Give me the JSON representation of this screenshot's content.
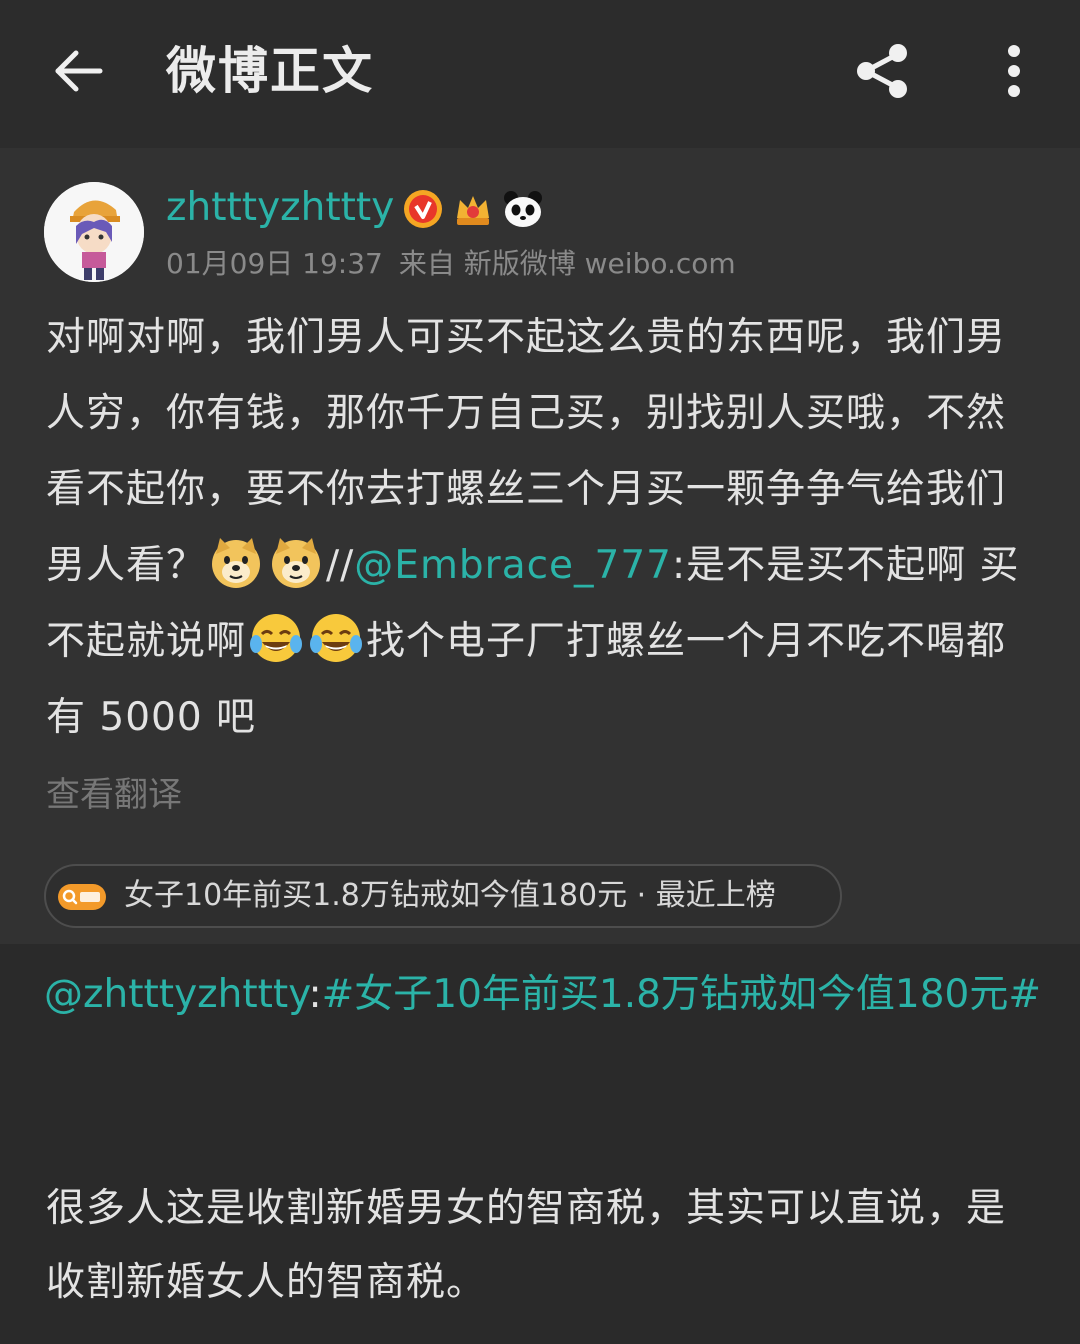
{
  "header": {
    "title": "微博正文",
    "back_icon": "arrow-left-icon",
    "share_icon": "share-icon",
    "more_icon": "more-vertical-icon"
  },
  "post": {
    "username": "zhtttyzhttty",
    "badges": [
      "verified-icon",
      "crown-icon",
      "panda-icon"
    ],
    "date": "01月09日 19:37",
    "source": "来自 新版微博 weibo.com",
    "text_part1": "对啊对啊，我们男人可买不起这么贵的东西呢，我们男人穷，你有钱，那你千万自己买，别找别人买哦，不然看不起你，要不你去打螺丝三个月买一颗争争气给我们男人看？",
    "separator": "//",
    "mention": "@Embrace_777",
    "text_part2": ":是不是买不起啊  买不起就说啊",
    "text_part3": "找个电子厂打螺丝一个月不吃不喝都有 5000 吧",
    "translate": "查看翻译",
    "topic_chip": "女子10年前买1.8万钻戒如今值180元 · 最近上榜",
    "colors": {
      "accent": "#2bb3a8",
      "background": "#2a2a2a",
      "card": "#323232"
    }
  },
  "repost": {
    "mention": "@zhtttyzhttty",
    "colon": ":",
    "hashtag": "#女子10年前买1.8万钻戒如今值180元#",
    "text": "很多人这是收割新婚男女的智商税，其实可以直说，是收割新婚女人的智商税。"
  }
}
